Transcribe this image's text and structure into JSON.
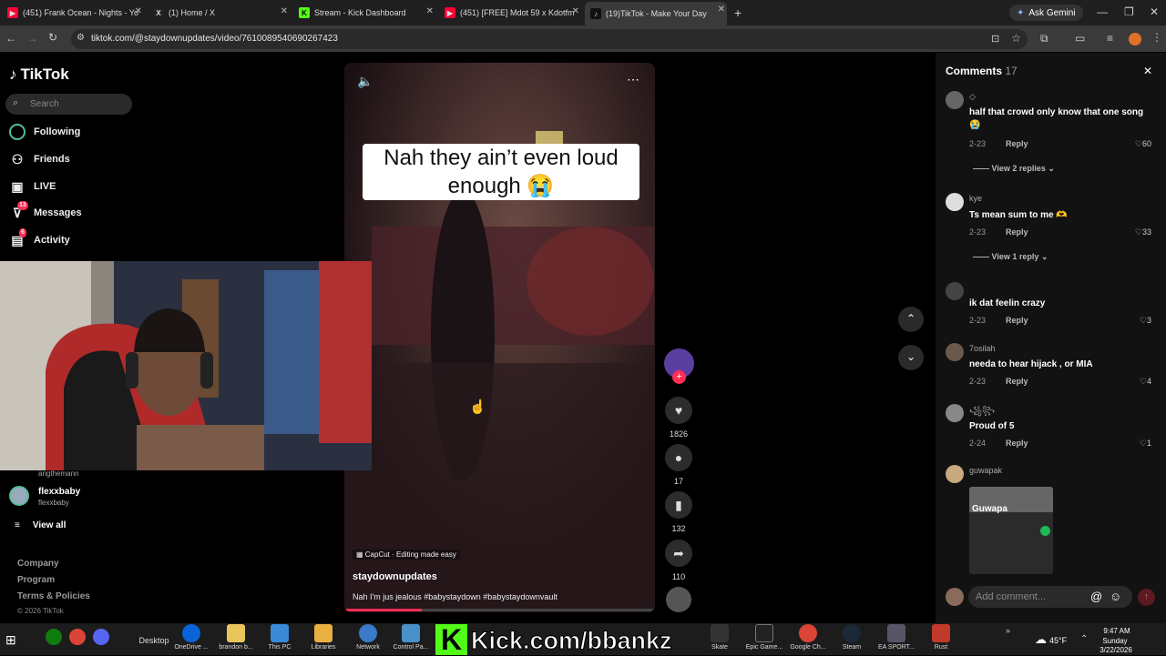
{
  "tabs": [
    {
      "label": "(451) Frank Ocean - Nights - Yo",
      "color": "#ff0033",
      "glyph": "▶"
    },
    {
      "label": "(1) Home / X",
      "color": "#222",
      "glyph": "X"
    },
    {
      "label": "Stream - Kick Dashboard",
      "color": "#53fc18",
      "glyph": "K"
    },
    {
      "label": "(451) [FREE] Mdot 59 x Kdotfm",
      "color": "#ff0033",
      "glyph": "▶"
    },
    {
      "label": "(19)TikTok - Make Your Day",
      "color": "#111",
      "glyph": "♪"
    }
  ],
  "ask_gemini": "Ask Gemini",
  "url": "tiktok.com/@staydownupdates/video/7610089540690267423",
  "sidebar": {
    "logo": "TikTok",
    "search_placeholder": "Search",
    "nav": [
      {
        "label": "Following",
        "icon": "following-icon"
      },
      {
        "label": "Friends",
        "icon": "friends-icon"
      },
      {
        "label": "LIVE",
        "icon": "live-icon"
      },
      {
        "label": "Messages",
        "icon": "messages-icon",
        "badge": "13"
      },
      {
        "label": "Activity",
        "icon": "activity-icon",
        "badge": "6"
      }
    ],
    "account_partial": "angthemann",
    "account": {
      "name": "flexxbaby",
      "handle": "flexxbaby"
    },
    "view_all": "View all",
    "footer": [
      "Company",
      "Program",
      "Terms & Policies",
      "© 2026 TikTok"
    ]
  },
  "video": {
    "caption": "Nah they ain’t even loud enough 😭",
    "capcut": "CapCut · Editing made easy",
    "author": "staydownupdates",
    "description": "Nah I'm jus jealous #babystaydown #babystaydownvault",
    "progress": 0.25
  },
  "actions": {
    "likes": "1826",
    "comments": "17",
    "saves": "132",
    "shares": "110"
  },
  "comments_panel": {
    "title": "Comments",
    "count": "17",
    "items": [
      {
        "user": "◇",
        "text": "half that crowd only know that one song 😭",
        "date": "2-23",
        "likes": "60",
        "replies": "View 2 replies"
      },
      {
        "user": "kye",
        "text": "Ts mean sum to me 🫶",
        "date": "2-23",
        "likes": "33",
        "replies": "View 1 reply"
      },
      {
        "user": "",
        "text": "ik dat feelin crazy",
        "date": "2-23",
        "likes": "3"
      },
      {
        "user": "7osilah",
        "text": "needa to hear hijack , or MIA",
        "date": "2-23",
        "likes": "4"
      },
      {
        "user": "꧁꧂",
        "text": "Proud of 5",
        "date": "2-24",
        "likes": "1"
      },
      {
        "user": "guwapak",
        "text": "",
        "date": "",
        "likes": ""
      }
    ],
    "reply_label": "Reply",
    "image_label": "Guwapa",
    "input_placeholder": "Add comment..."
  },
  "overlay": "Kick.com/bbankz",
  "taskbar": {
    "items": [
      "Desktop",
      "OneDrive ...",
      "brandon b...",
      "This PC",
      "Libraries",
      "Network",
      "Control Pa...",
      "Skate",
      "Epic Game...",
      "Google Ch...",
      "Steam",
      "EA SPORT...",
      "Rust"
    ],
    "weather": "45°F",
    "time": "9:47 AM",
    "day": "Sunday",
    "date": "3/22/2026"
  }
}
